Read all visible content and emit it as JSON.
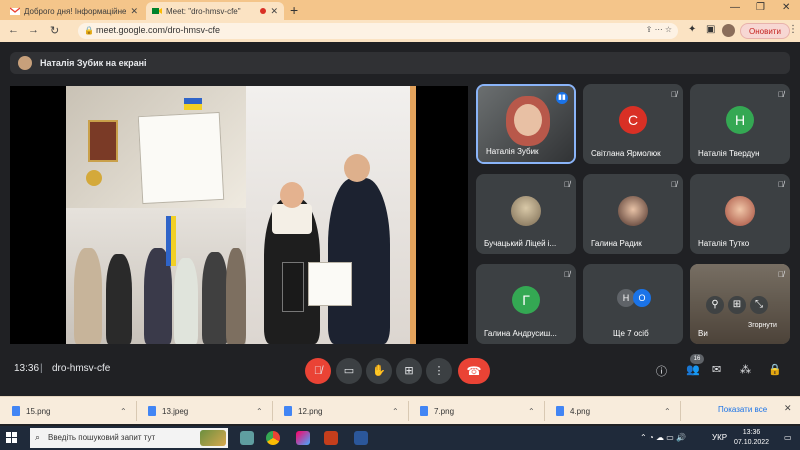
{
  "browser": {
    "tabs": [
      {
        "title": "Доброго дня! Інформаційне п...",
        "icon": "gmail-icon"
      },
      {
        "title": "Meet: \"dro-hmsv-cfe\"",
        "icon": "meet-icon",
        "recording": true
      }
    ],
    "url": "meet.google.com/dro-hmsv-cfe",
    "update_label": "Оновити"
  },
  "meet": {
    "presenter_banner": "Наталія Зубик на екрані",
    "participants": [
      {
        "name": "Наталія Зубик",
        "kind": "video",
        "speaking": true
      },
      {
        "name": "Світлана Ярмолюк",
        "kind": "letter",
        "letter": "С",
        "color": "#d93025"
      },
      {
        "name": "Наталія Твердун",
        "kind": "letter",
        "letter": "Н",
        "color": "#34a853"
      },
      {
        "name": "Бучацький Ліцей і...",
        "kind": "photo"
      },
      {
        "name": "Галина Радик",
        "kind": "photo"
      },
      {
        "name": "Наталія Тутко",
        "kind": "photo"
      },
      {
        "name": "Галина Андрусиш...",
        "kind": "letter",
        "letter": "Г",
        "color": "#34a853"
      },
      {
        "name": "Ще 7 осіб",
        "kind": "more",
        "letters": [
          "Н",
          "О"
        ]
      },
      {
        "name": "Ви",
        "kind": "self",
        "collapse_label": "Згорнути"
      }
    ],
    "time": "13:36",
    "separator": "|",
    "meeting_code": "dro-hmsv-cfe",
    "people_count": "16"
  },
  "downloads": {
    "files": [
      "15.png",
      "13.jpeg",
      "12.png",
      "7.png",
      "4.png"
    ],
    "show_all": "Показати все"
  },
  "taskbar": {
    "search_placeholder": "Введіть пошуковий запит тут",
    "language": "УКР",
    "time": "13:36",
    "date": "07.10.2022"
  },
  "colors": {
    "meet_bg": "#202124",
    "tile_bg": "#3c4043",
    "end_call": "#ea4335",
    "tab_strip": "#f4c58a"
  }
}
